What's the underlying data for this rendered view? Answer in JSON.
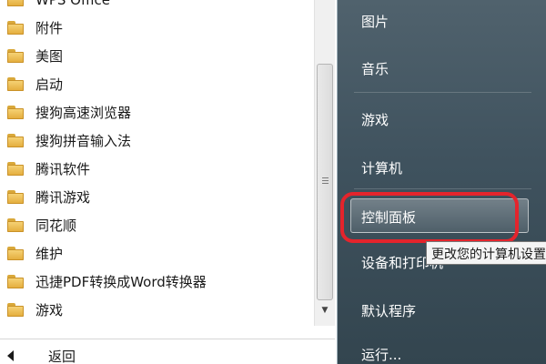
{
  "programs": [
    {
      "label": "WPS Office",
      "icon": "folder-icon"
    },
    {
      "label": "附件",
      "icon": "folder-icon"
    },
    {
      "label": "美图",
      "icon": "folder-icon"
    },
    {
      "label": "启动",
      "icon": "folder-icon"
    },
    {
      "label": "搜狗高速浏览器",
      "icon": "folder-icon"
    },
    {
      "label": "搜狗拼音输入法",
      "icon": "folder-icon"
    },
    {
      "label": "腾讯软件",
      "icon": "folder-icon"
    },
    {
      "label": "腾讯游戏",
      "icon": "folder-icon"
    },
    {
      "label": "同花顺",
      "icon": "folder-icon"
    },
    {
      "label": "维护",
      "icon": "folder-icon"
    },
    {
      "label": "迅捷PDF转换成Word转换器",
      "icon": "folder-icon"
    },
    {
      "label": "游戏",
      "icon": "folder-icon"
    }
  ],
  "back": {
    "label": "返回"
  },
  "right_menu": {
    "pictures": "图片",
    "music": "音乐",
    "games": "游戏",
    "computer": "计算机",
    "control_panel": "控制面板",
    "devices_printers": "设备和打印机",
    "default_programs": "默认程序",
    "run": "运行..."
  },
  "tooltip": "更改您的计算机设置",
  "colors": {
    "highlight_ring": "#e4242c",
    "right_pane": "#3f525e"
  }
}
